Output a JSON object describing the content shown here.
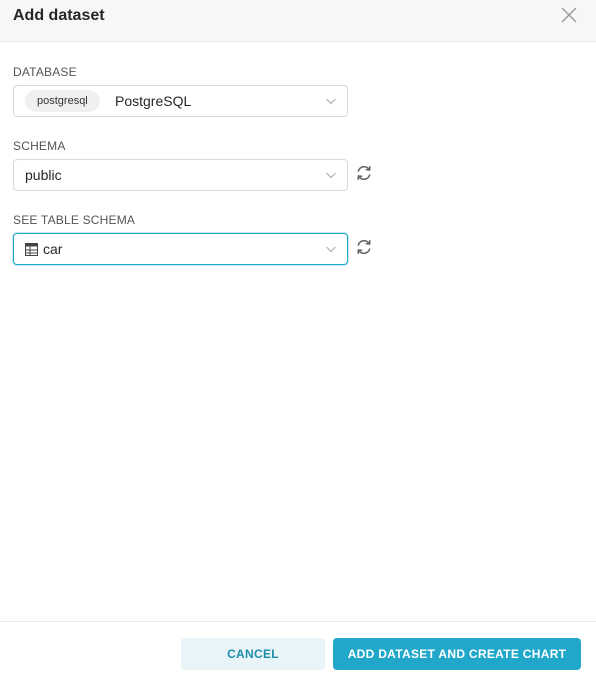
{
  "modal": {
    "title": "Add dataset"
  },
  "database": {
    "label": "DATABASE",
    "tag": "postgresql",
    "value": "PostgreSQL"
  },
  "schema": {
    "label": "SCHEMA",
    "value": "public"
  },
  "table": {
    "label": "SEE TABLE SCHEMA",
    "value": "car"
  },
  "footer": {
    "cancel_label": "CANCEL",
    "primary_label": "ADD DATASET AND CREATE CHART"
  },
  "colors": {
    "accent": "#20a7c9",
    "cancel_bg": "#e8f4f8",
    "header_bg": "#f7f7f7"
  },
  "icons": {
    "close": "close-icon",
    "chevron": "chevron-down-icon",
    "refresh": "refresh-icon",
    "table": "table-icon"
  }
}
